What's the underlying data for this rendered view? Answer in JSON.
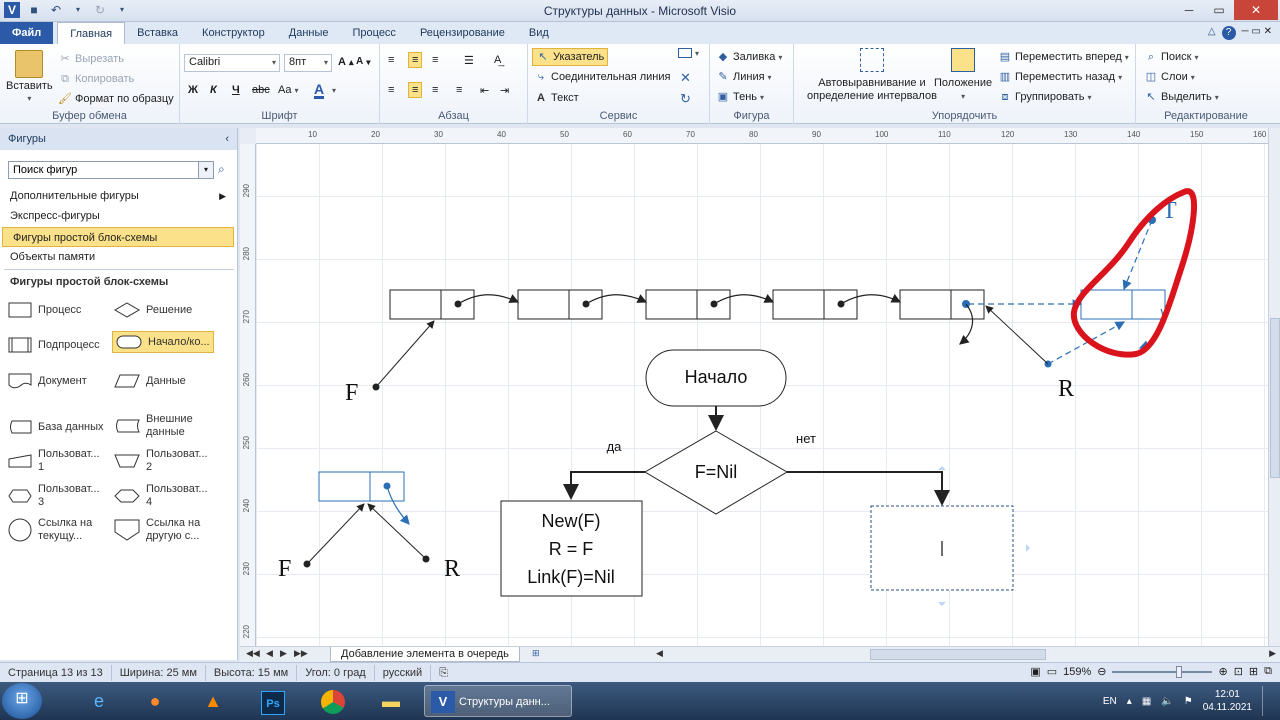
{
  "window": {
    "title": "Структуры данных  -  Microsoft Visio"
  },
  "tabs": {
    "file": "Файл",
    "items": [
      "Главная",
      "Вставка",
      "Конструктор",
      "Данные",
      "Процесс",
      "Рецензирование",
      "Вид"
    ]
  },
  "ribbon": {
    "clipboard": {
      "paste": "Вставить",
      "cut": "Вырезать",
      "copy": "Копировать",
      "format_painter": "Формат по образцу",
      "label": "Буфер обмена"
    },
    "font": {
      "family": "Calibri",
      "size": "8пт",
      "label": "Шрифт"
    },
    "paragraph": {
      "label": "Абзац"
    },
    "tools": {
      "pointer": "Указатель",
      "connector": "Соединительная линия",
      "text": "Текст",
      "label": "Сервис"
    },
    "shape": {
      "fill": "Заливка",
      "line": "Линия",
      "shadow": "Тень",
      "label": "Фигура"
    },
    "arrange": {
      "auto_align": "Автовыравнивание и определение интервалов",
      "position": "Положение",
      "bring_forward": "Переместить вперед",
      "send_backward": "Переместить назад",
      "group": "Группировать",
      "label": "Упорядочить"
    },
    "editing": {
      "find": "Поиск",
      "layers": "Слои",
      "select": "Выделить",
      "label": "Редактирование"
    }
  },
  "shapes_panel": {
    "title": "Фигуры",
    "search_value": "Поиск фигур",
    "stencils": [
      "Дополнительные фигуры",
      "Экспресс-фигуры",
      "Фигуры простой блок-схемы",
      "Объекты памяти"
    ],
    "active_stencil": "Фигуры простой блок-схемы",
    "section_title": "Фигуры простой блок-схемы",
    "items": [
      "Процесс",
      "Решение",
      "Подпроцесс",
      "Начало/ко...",
      "Документ",
      "Данные",
      "База данных",
      "Внешние данные",
      "Пользоват... 1",
      "Пользоват... 2",
      "Пользоват... 3",
      "Пользоват... 4",
      "Ссылка на текущу...",
      "Ссылка на другую с..."
    ]
  },
  "rulers": {
    "top": [
      "10",
      "20",
      "30",
      "40",
      "50",
      "60",
      "70",
      "80",
      "90",
      "100",
      "110",
      "120",
      "130",
      "140",
      "150",
      "160",
      "170",
      "180"
    ],
    "left": [
      "290",
      "280",
      "270",
      "260",
      "250",
      "240",
      "230",
      "220",
      "210"
    ]
  },
  "diagram": {
    "start": "Начало",
    "decision": "F=Nil",
    "yes": "да",
    "no": "нет",
    "process_lines": [
      "New(F)",
      "R = F",
      "Link(F)=Nil"
    ],
    "label_F": "F",
    "label_R": "R",
    "label_T": "T",
    "annotation_color": "#d9141c",
    "link_color": "#2a6fb5"
  },
  "pagebar": {
    "tab": "Добавление элемента в очередь"
  },
  "status": {
    "page": "Страница 13 из 13",
    "width": "Ширина: 25 мм",
    "height": "Высота: 15 мм",
    "angle": "Угол: 0 град",
    "language": "русский",
    "zoom": "159%"
  },
  "taskbar": {
    "visio_task": "Структуры данн...",
    "lang": "EN",
    "time": "12:01",
    "date": "04.11.2021"
  }
}
